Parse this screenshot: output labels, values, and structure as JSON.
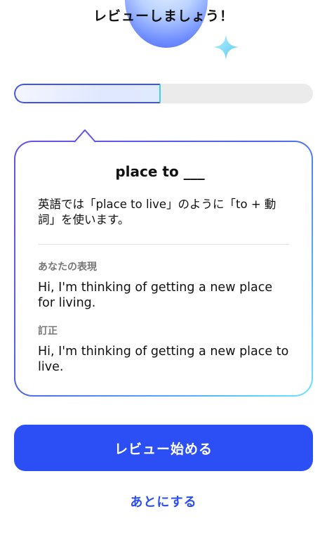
{
  "header": {
    "title": "レビューしましょう！"
  },
  "progress": {
    "fraction": 0.49
  },
  "card": {
    "title": "place to ___",
    "explanation": "英語では「place to live」のように「to + 動詞」を使います。",
    "your_label": "あなたの表現",
    "your_text": "Hi, I'm thinking of getting a new place for living.",
    "fix_label": "訂正",
    "fix_text": "Hi, I'm thinking of getting a new place to live."
  },
  "actions": {
    "start_label": "レビュー始める",
    "later_label": "あとにする"
  },
  "colors": {
    "accent": "#2b4ef5",
    "card_gradient_start": "#6b4fe8",
    "card_gradient_end": "#6be6ff",
    "progress_track": "#ebebeb"
  }
}
